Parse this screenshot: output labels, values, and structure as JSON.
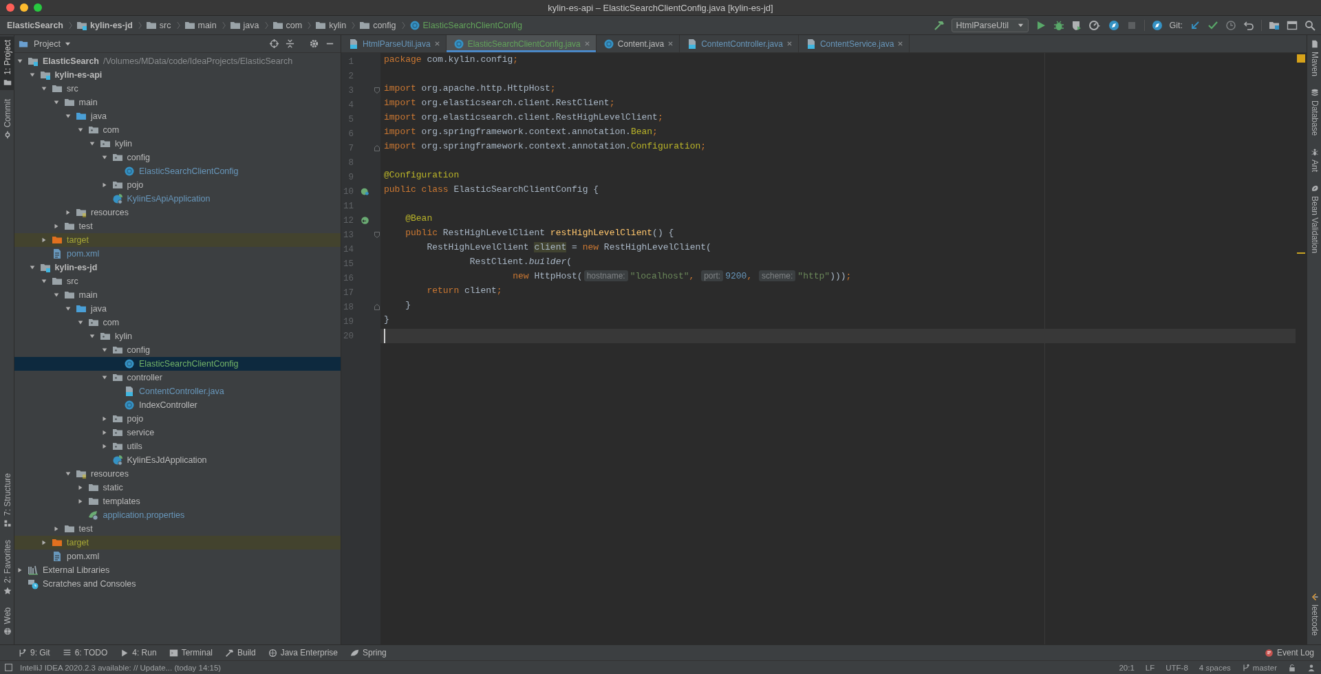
{
  "window": {
    "title": "kylin-es-api – ElasticSearchClientConfig.java [kylin-es-jd]"
  },
  "breadcrumbs": [
    {
      "label": "ElasticSearch",
      "kind": "project"
    },
    {
      "label": "kylin-es-jd",
      "kind": "module"
    },
    {
      "label": "src",
      "kind": "folder"
    },
    {
      "label": "main",
      "kind": "folder"
    },
    {
      "label": "java",
      "kind": "folder"
    },
    {
      "label": "com",
      "kind": "folder"
    },
    {
      "label": "kylin",
      "kind": "folder"
    },
    {
      "label": "config",
      "kind": "folder"
    },
    {
      "label": "ElasticSearchClientConfig",
      "kind": "class",
      "color": "#62a35a"
    }
  ],
  "toolbar": {
    "run_config": "HtmlParseUtil",
    "stop_enabled": false,
    "git_label": "Git:"
  },
  "left_tools_top": [
    {
      "label": "1: Project",
      "kind": "project",
      "selected": true
    },
    {
      "label": "Commit",
      "kind": "commit",
      "selected": false
    }
  ],
  "left_tools_bottom": [
    {
      "label": "7: Structure",
      "kind": "structure",
      "selected": false
    },
    {
      "label": "2: Favorites",
      "kind": "favorites",
      "selected": false
    },
    {
      "label": "Web",
      "kind": "web",
      "selected": false
    }
  ],
  "right_tools_top": [
    {
      "label": "Maven",
      "kind": "maven",
      "selected": false
    },
    {
      "label": "Database",
      "kind": "database",
      "selected": false
    },
    {
      "label": "Ant",
      "kind": "ant",
      "selected": false
    },
    {
      "label": "Bean Validation",
      "kind": "bean",
      "selected": false
    }
  ],
  "right_tools_bottom": [
    {
      "label": "leetcode",
      "kind": "leetcode",
      "selected": false
    }
  ],
  "project": {
    "title": "Project",
    "tree": [
      {
        "label": "ElasticSearch",
        "kind": "module",
        "path": "/Volumes/MData/code/IdeaProjects/ElasticSearch",
        "expanded": true,
        "selected": false,
        "children": [
          {
            "label": "kylin-es-api",
            "kind": "module",
            "expanded": true,
            "selected": false,
            "children": [
              {
                "label": "src",
                "kind": "folder",
                "expanded": true,
                "selected": false,
                "children": [
                  {
                    "label": "main",
                    "kind": "folder",
                    "expanded": true,
                    "selected": false,
                    "children": [
                      {
                        "label": "java",
                        "kind": "source",
                        "expanded": true,
                        "selected": false,
                        "children": [
                          {
                            "label": "com",
                            "kind": "package",
                            "expanded": true,
                            "selected": false,
                            "children": [
                              {
                                "label": "kylin",
                                "kind": "package",
                                "expanded": true,
                                "selected": false,
                                "children": [
                                  {
                                    "label": "config",
                                    "kind": "package",
                                    "expanded": true,
                                    "selected": false,
                                    "children": [
                                      {
                                        "label": "ElasticSearchClientConfig",
                                        "kind": "class",
                                        "color": "#6897bb",
                                        "selected": false
                                      }
                                    ]
                                  },
                                  {
                                    "label": "pojo",
                                    "kind": "package",
                                    "expanded": false,
                                    "selected": false
                                  },
                                  {
                                    "label": "KylinEsApiApplication",
                                    "kind": "spring-class",
                                    "color": "#6897bb",
                                    "selected": false
                                  }
                                ]
                              }
                            ]
                          }
                        ]
                      },
                      {
                        "label": "resources",
                        "kind": "resources",
                        "expanded": false,
                        "selected": false
                      }
                    ]
                  },
                  {
                    "label": "test",
                    "kind": "folder",
                    "expanded": false,
                    "selected": false
                  }
                ]
              },
              {
                "label": "target",
                "kind": "excluded",
                "color": "#a8a836",
                "expanded": false,
                "selected": false
              },
              {
                "label": "pom.xml",
                "kind": "maven",
                "color": "#6897bb",
                "selected": false
              }
            ]
          },
          {
            "label": "kylin-es-jd",
            "kind": "module",
            "expanded": true,
            "selected": false,
            "children": [
              {
                "label": "src",
                "kind": "folder",
                "expanded": true,
                "selected": false,
                "children": [
                  {
                    "label": "main",
                    "kind": "folder",
                    "expanded": true,
                    "selected": false,
                    "children": [
                      {
                        "label": "java",
                        "kind": "source",
                        "expanded": true,
                        "selected": false,
                        "children": [
                          {
                            "label": "com",
                            "kind": "package",
                            "expanded": true,
                            "selected": false,
                            "children": [
                              {
                                "label": "kylin",
                                "kind": "package",
                                "expanded": true,
                                "selected": false,
                                "children": [
                                  {
                                    "label": "config",
                                    "kind": "package",
                                    "expanded": true,
                                    "selected": false,
                                    "children": [
                                      {
                                        "label": "ElasticSearchClientConfig",
                                        "kind": "class",
                                        "color": "#73b368",
                                        "selected": true
                                      }
                                    ]
                                  },
                                  {
                                    "label": "controller",
                                    "kind": "package",
                                    "expanded": true,
                                    "selected": false,
                                    "children": [
                                      {
                                        "label": "ContentController.java",
                                        "kind": "java-file",
                                        "color": "#6897bb",
                                        "selected": false
                                      },
                                      {
                                        "label": "IndexController",
                                        "kind": "class",
                                        "selected": false
                                      }
                                    ]
                                  },
                                  {
                                    "label": "pojo",
                                    "kind": "package",
                                    "expanded": false,
                                    "selected": false
                                  },
                                  {
                                    "label": "service",
                                    "kind": "package",
                                    "expanded": false,
                                    "selected": false
                                  },
                                  {
                                    "label": "utils",
                                    "kind": "package",
                                    "expanded": false,
                                    "selected": false
                                  },
                                  {
                                    "label": "KylinEsJdApplication",
                                    "kind": "spring-class",
                                    "selected": false
                                  }
                                ]
                              }
                            ]
                          }
                        ]
                      },
                      {
                        "label": "resources",
                        "kind": "resources",
                        "expanded": true,
                        "selected": false,
                        "children": [
                          {
                            "label": "static",
                            "kind": "folder",
                            "expanded": false,
                            "selected": false
                          },
                          {
                            "label": "templates",
                            "kind": "folder",
                            "expanded": false,
                            "selected": false
                          },
                          {
                            "label": "application.properties",
                            "kind": "properties",
                            "color": "#6897bb",
                            "selected": false
                          }
                        ]
                      }
                    ]
                  },
                  {
                    "label": "test",
                    "kind": "folder",
                    "expanded": false,
                    "selected": false
                  }
                ]
              },
              {
                "label": "target",
                "kind": "excluded",
                "color": "#a8a836",
                "expanded": false,
                "selected": false
              },
              {
                "label": "pom.xml",
                "kind": "maven",
                "selected": false
              }
            ]
          }
        ]
      },
      {
        "label": "External Libraries",
        "kind": "libraries",
        "expanded": false,
        "selected": false
      },
      {
        "label": "Scratches and Consoles",
        "kind": "scratches",
        "selected": false
      }
    ]
  },
  "tabs": [
    {
      "label": "HtmlParseUtil.java",
      "kind": "java-file",
      "color": "#6897bb",
      "selected": false
    },
    {
      "label": "ElasticSearchClientConfig.java",
      "kind": "class",
      "color": "#62a35a",
      "selected": true
    },
    {
      "label": "Content.java",
      "kind": "class",
      "selected": false
    },
    {
      "label": "ContentController.java",
      "kind": "java-file",
      "color": "#6897bb",
      "selected": false
    },
    {
      "label": "ContentService.java",
      "kind": "java-file",
      "color": "#6897bb",
      "selected": false
    }
  ],
  "code": [
    {
      "number": "1",
      "current": false,
      "tokens": [
        {
          "kind": "keyword",
          "text": "package"
        },
        {
          "kind": "plain",
          "text": " com.kylin.config"
        },
        {
          "kind": "keyword",
          "text": ";"
        }
      ]
    },
    {
      "number": "2",
      "current": false
    },
    {
      "number": "3",
      "current": false,
      "fold": {
        "kind": "start"
      },
      "tokens": [
        {
          "kind": "keyword",
          "text": "import"
        },
        {
          "kind": "plain",
          "text": " org.apache.http.HttpHost"
        },
        {
          "kind": "keyword",
          "text": ";"
        }
      ]
    },
    {
      "number": "4",
      "current": false,
      "tokens": [
        {
          "kind": "keyword",
          "text": "import"
        },
        {
          "kind": "plain",
          "text": " org.elasticsearch.client.RestClient"
        },
        {
          "kind": "keyword",
          "text": ";"
        }
      ]
    },
    {
      "number": "5",
      "current": false,
      "tokens": [
        {
          "kind": "keyword",
          "text": "import"
        },
        {
          "kind": "plain",
          "text": " org.elasticsearch.client.RestHighLevelClient"
        },
        {
          "kind": "keyword",
          "text": ";"
        }
      ]
    },
    {
      "number": "6",
      "current": false,
      "tokens": [
        {
          "kind": "keyword",
          "text": "import"
        },
        {
          "kind": "plain",
          "text": " org.springframework.context.annotation."
        },
        {
          "kind": "annotation",
          "text": "Bean"
        },
        {
          "kind": "keyword",
          "text": ";"
        }
      ]
    },
    {
      "number": "7",
      "current": false,
      "fold": {
        "kind": "end"
      },
      "tokens": [
        {
          "kind": "keyword",
          "text": "import"
        },
        {
          "kind": "plain",
          "text": " org.springframework.context.annotation."
        },
        {
          "kind": "annotation",
          "text": "Configuration"
        },
        {
          "kind": "keyword",
          "text": ";"
        }
      ]
    },
    {
      "number": "8",
      "current": false
    },
    {
      "number": "9",
      "current": false,
      "tokens": [
        {
          "kind": "annotation",
          "text": "@Configuration"
        }
      ]
    },
    {
      "number": "10",
      "current": false,
      "gutter": {
        "kind": "config"
      },
      "tokens": [
        {
          "kind": "keyword",
          "text": "public class"
        },
        {
          "kind": "plain",
          "text": " ElasticSearchClientConfig {"
        }
      ]
    },
    {
      "number": "11",
      "current": false
    },
    {
      "number": "12",
      "current": false,
      "gutter": {
        "kind": "bean"
      },
      "tokens": [
        {
          "kind": "annotation",
          "text": "    @Bean"
        }
      ]
    },
    {
      "number": "13",
      "current": false,
      "fold": {
        "kind": "start"
      },
      "tokens": [
        {
          "kind": "keyword",
          "text": "    public"
        },
        {
          "kind": "plain",
          "text": " RestHighLevelClient "
        },
        {
          "kind": "method",
          "text": "restHighLevelClient"
        },
        {
          "kind": "plain",
          "text": "() {"
        }
      ]
    },
    {
      "number": "14",
      "current": false,
      "tokens": [
        {
          "kind": "plain",
          "text": "        RestHighLevelClient "
        },
        {
          "kind": "highlight",
          "text": "client"
        },
        {
          "kind": "plain",
          "text": " = "
        },
        {
          "kind": "keyword",
          "text": "new"
        },
        {
          "kind": "plain",
          "text": " RestHighLevelClient("
        }
      ]
    },
    {
      "number": "15",
      "current": false,
      "tokens": [
        {
          "kind": "plain",
          "text": "                RestClient."
        },
        {
          "kind": "italic",
          "text": "builder"
        },
        {
          "kind": "plain",
          "text": "("
        }
      ]
    },
    {
      "number": "16",
      "current": false,
      "tokens": [
        {
          "kind": "keyword",
          "text": "                        new"
        },
        {
          "kind": "plain",
          "text": " HttpHost("
        },
        {
          "kind": "hint",
          "text": "hostname:"
        },
        {
          "kind": "string",
          "text": "\"localhost\""
        },
        {
          "kind": "keyword",
          "text": ", "
        },
        {
          "kind": "hint",
          "text": "port:"
        },
        {
          "kind": "number",
          "text": "9200"
        },
        {
          "kind": "keyword",
          "text": ", "
        },
        {
          "kind": "hint",
          "text": "scheme:"
        },
        {
          "kind": "string",
          "text": "\"http\""
        },
        {
          "kind": "plain",
          "text": ")))"
        },
        {
          "kind": "keyword",
          "text": ";"
        }
      ]
    },
    {
      "number": "17",
      "current": false,
      "tokens": [
        {
          "kind": "keyword",
          "text": "        return"
        },
        {
          "kind": "plain",
          "text": " client"
        },
        {
          "kind": "keyword",
          "text": ";"
        }
      ]
    },
    {
      "number": "18",
      "current": false,
      "fold": {
        "kind": "end"
      },
      "tokens": [
        {
          "kind": "plain",
          "text": "    }"
        }
      ]
    },
    {
      "number": "19",
      "current": false,
      "tokens": [
        {
          "kind": "plain",
          "text": "}"
        }
      ]
    },
    {
      "number": "20",
      "current": true
    }
  ],
  "bottom_tools": [
    {
      "label": "9: Git",
      "kind": "git"
    },
    {
      "label": "6: TODO",
      "kind": "todo"
    },
    {
      "label": "4: Run",
      "kind": "run"
    },
    {
      "label": "Terminal",
      "kind": "terminal"
    },
    {
      "label": "Build",
      "kind": "build"
    },
    {
      "label": "Java Enterprise",
      "kind": "enterprise"
    },
    {
      "label": "Spring",
      "kind": "spring"
    }
  ],
  "event_log": "Event Log",
  "status_bar": {
    "message": "IntelliJ IDEA 2020.2.3 available: // Update... (today 14:15)",
    "items": [
      "20:1",
      "LF",
      "UTF-8",
      "4 spaces"
    ],
    "branch": "master"
  }
}
